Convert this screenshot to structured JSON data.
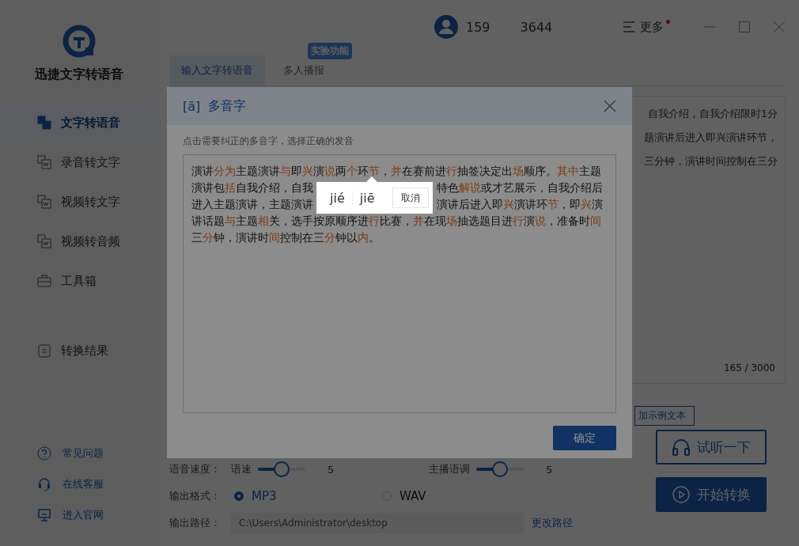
{
  "sidebar": {
    "app_name": "迅捷文字转语音",
    "nav": [
      {
        "label": "文字转语音",
        "selected": true
      },
      {
        "label": "录音转文字",
        "selected": false
      },
      {
        "label": "视频转文字",
        "selected": false
      },
      {
        "label": "视频转音频",
        "selected": false
      },
      {
        "label": "工具箱",
        "selected": false
      },
      {
        "label": "转换结果",
        "selected": false
      }
    ],
    "links": [
      "常见问题",
      "在线客服",
      "进入官网"
    ]
  },
  "header": {
    "account": [
      "159",
      "3644"
    ],
    "more": "更多",
    "more_dot": true
  },
  "tabs": [
    {
      "label": "输入文字转语音",
      "selected": true
    },
    {
      "label": "多人播报",
      "selected": false,
      "badge": "实验功能"
    }
  ],
  "editor": {
    "lines": [
      "自我介绍，自我介绍限时1分",
      "题演讲后进入即兴演讲环节，",
      "三分钟，演讲时间控制在三分"
    ],
    "counter": "165 / 3000",
    "example_button": "加示例文本"
  },
  "settings": {
    "speed": {
      "label": "语音速度：",
      "sliders": [
        {
          "label": "语速",
          "level": 0.5,
          "value": "5"
        },
        {
          "label": "主播语调",
          "level": 0.5,
          "value": "5"
        }
      ]
    },
    "format": {
      "label": "输出格式：",
      "options": [
        {
          "label": "MP3",
          "selected": true
        },
        {
          "label": "WAV",
          "selected": false
        }
      ]
    },
    "path": {
      "label": "输出路径：",
      "value": "C:\\Users\\Administrator\\desktop",
      "change": "更改路径"
    }
  },
  "actions": [
    "试听一下",
    "开始转换"
  ],
  "dialog": {
    "icon_text": "[ā]",
    "title": "多音字",
    "hint": "点击需要纠正的多音字，选择正确的发音",
    "lines": [
      {
        "parts": [
          [
            {
              "t": "演讲",
              "poly": false
            },
            {
              "t": "分为",
              "poly": true
            },
            {
              "t": "主题演讲",
              "poly": false
            },
            {
              "t": "与",
              "poly": true
            },
            {
              "t": "即",
              "poly": false
            },
            {
              "t": "兴",
              "poly": true
            },
            {
              "t": "演",
              "poly": false
            },
            {
              "t": "说",
              "poly": true
            },
            {
              "t": "两",
              "poly": false
            },
            {
              "t": "个",
              "poly": true
            },
            {
              "t": "环",
              "poly": false
            },
            {
              "t": "节",
              "poly": true
            },
            {
              "t": "，",
              "poly": false
            },
            {
              "t": "并",
              "poly": true
            },
            {
              "t": "在赛前进",
              "poly": false
            },
            {
              "t": "行",
              "poly": true
            },
            {
              "t": "抽签决定出",
              "poly": false
            },
            {
              "t": "场",
              "poly": true
            },
            {
              "t": "顺序。",
              "poly": false
            },
            {
              "t": "其中",
              "poly": true
            },
            {
              "t": "主题",
              "poly": false
            }
          ]
        ]
      },
      {
        "parts": [
          [
            {
              "t": "演讲包",
              "poly": false
            },
            {
              "t": "括",
              "poly": true
            },
            {
              "t": "自我介绍，自我",
              "poly": false
            }
          ],
          [
            {
              "t": "特色",
              "poly": false
            },
            {
              "t": "解说",
              "poly": true
            },
            {
              "t": "或才艺展示，自我介绍后",
              "poly": false
            }
          ]
        ]
      },
      {
        "parts": [
          [
            {
              "t": "进入主题演讲，主题演讲",
              "poly": false
            }
          ],
          [
            {
              "t": "演讲后进入即",
              "poly": false
            },
            {
              "t": "兴",
              "poly": true
            },
            {
              "t": "演讲环",
              "poly": false
            },
            {
              "t": "节",
              "poly": true
            },
            {
              "t": "，即",
              "poly": false
            },
            {
              "t": "兴",
              "poly": true
            },
            {
              "t": "演",
              "poly": false
            }
          ]
        ]
      },
      {
        "parts": [
          [
            {
              "t": "讲话题",
              "poly": false
            },
            {
              "t": "与",
              "poly": true
            },
            {
              "t": "主题",
              "poly": false
            },
            {
              "t": "相",
              "poly": true
            },
            {
              "t": "关，选手按原顺序进",
              "poly": false
            },
            {
              "t": "行",
              "poly": true
            },
            {
              "t": "比赛，",
              "poly": false
            },
            {
              "t": "并",
              "poly": true
            },
            {
              "t": "在现",
              "poly": false
            },
            {
              "t": "场",
              "poly": true
            },
            {
              "t": "抽选题目进",
              "poly": false
            },
            {
              "t": "行",
              "poly": true
            },
            {
              "t": "演",
              "poly": false
            },
            {
              "t": "说",
              "poly": true
            },
            {
              "t": "，准备时",
              "poly": false
            },
            {
              "t": "间",
              "poly": true
            }
          ]
        ]
      },
      {
        "parts": [
          [
            {
              "t": "三",
              "poly": false
            },
            {
              "t": "分",
              "poly": true
            },
            {
              "t": "钟，演讲时",
              "poly": false
            },
            {
              "t": "间",
              "poly": true
            },
            {
              "t": "控制在三",
              "poly": false
            },
            {
              "t": "分",
              "poly": true
            },
            {
              "t": "钟以",
              "poly": false
            },
            {
              "t": "内",
              "poly": true
            },
            {
              "t": "。",
              "poly": false
            }
          ]
        ]
      }
    ],
    "ok": "确定"
  },
  "popup": {
    "options": [
      "jié",
      "jiē"
    ],
    "cancel": "取消"
  }
}
